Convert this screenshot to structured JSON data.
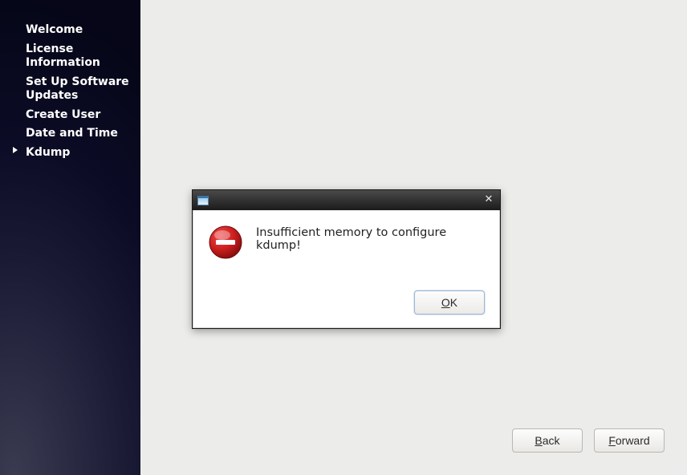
{
  "sidebar": {
    "items": [
      {
        "label": "Welcome",
        "active": false
      },
      {
        "label": "License Information",
        "active": false
      },
      {
        "label": "Set Up Software Updates",
        "active": false
      },
      {
        "label": "Create User",
        "active": false
      },
      {
        "label": "Date and Time",
        "active": false
      },
      {
        "label": "Kdump",
        "active": true
      }
    ]
  },
  "dialog": {
    "message": "Insufficient memory to configure kdump!",
    "ok_label_underline": "O",
    "ok_label_rest": "K"
  },
  "footer": {
    "back_underline": "B",
    "back_rest": "ack",
    "forward_underline": "F",
    "forward_rest": "orward"
  }
}
